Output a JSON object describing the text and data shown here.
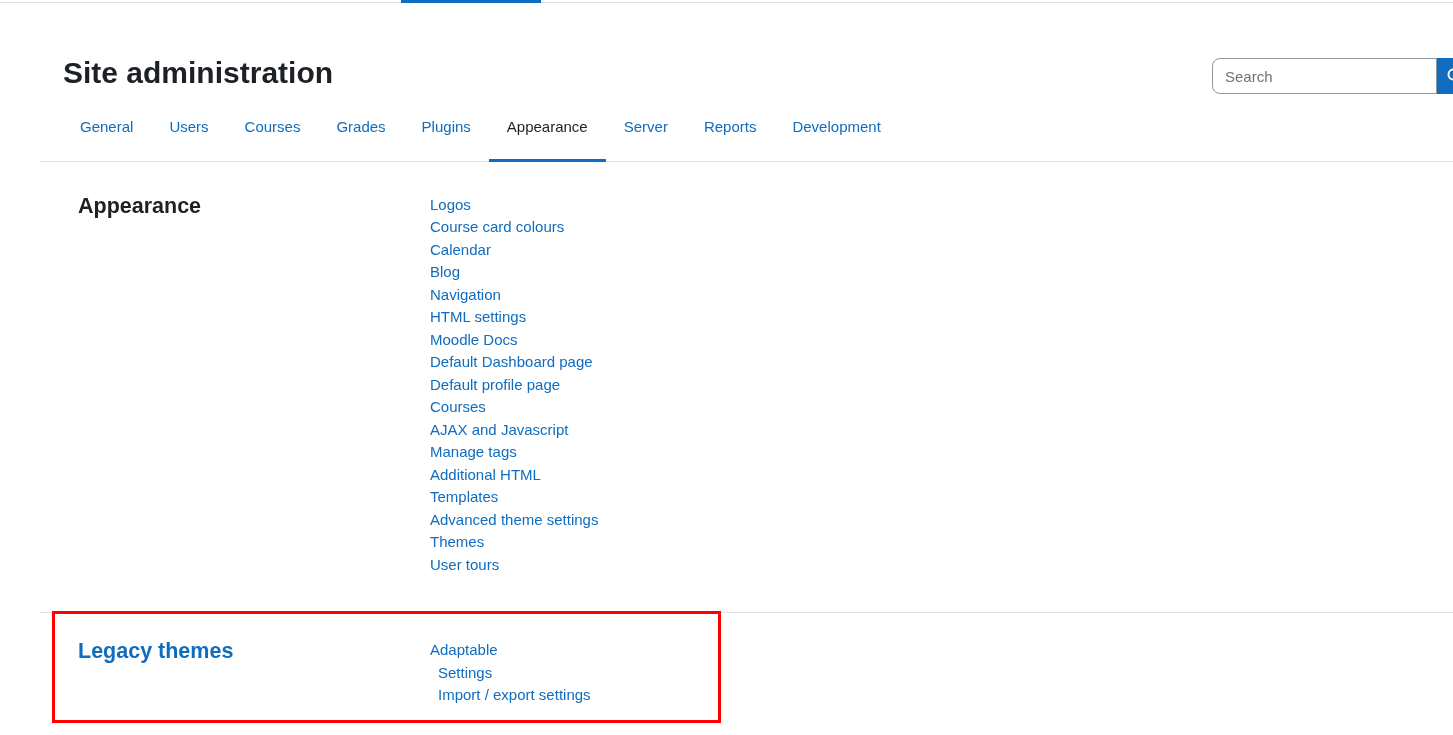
{
  "page_title": "Site administration",
  "search": {
    "placeholder": "Search"
  },
  "tabs": [
    {
      "label": "General",
      "selected": false
    },
    {
      "label": "Users",
      "selected": false
    },
    {
      "label": "Courses",
      "selected": false
    },
    {
      "label": "Grades",
      "selected": false
    },
    {
      "label": "Plugins",
      "selected": false
    },
    {
      "label": "Appearance",
      "selected": true
    },
    {
      "label": "Server",
      "selected": false
    },
    {
      "label": "Reports",
      "selected": false
    },
    {
      "label": "Development",
      "selected": false
    }
  ],
  "sections": [
    {
      "title": "Appearance",
      "title_is_link": false,
      "highlighted": false,
      "links": [
        {
          "label": "Logos"
        },
        {
          "label": "Course card colours"
        },
        {
          "label": "Calendar"
        },
        {
          "label": "Blog"
        },
        {
          "label": "Navigation"
        },
        {
          "label": "HTML settings"
        },
        {
          "label": "Moodle Docs"
        },
        {
          "label": "Default Dashboard page"
        },
        {
          "label": "Default profile page"
        },
        {
          "label": "Courses"
        },
        {
          "label": "AJAX and Javascript"
        },
        {
          "label": "Manage tags"
        },
        {
          "label": "Additional HTML"
        },
        {
          "label": "Templates"
        },
        {
          "label": "Advanced theme settings"
        },
        {
          "label": "Themes"
        },
        {
          "label": "User tours"
        }
      ]
    },
    {
      "title": "Legacy themes",
      "title_is_link": true,
      "highlighted": true,
      "links": [
        {
          "label": "Adaptable",
          "children": [
            {
              "label": "Settings"
            },
            {
              "label": "Import / export settings"
            }
          ]
        }
      ]
    }
  ]
}
